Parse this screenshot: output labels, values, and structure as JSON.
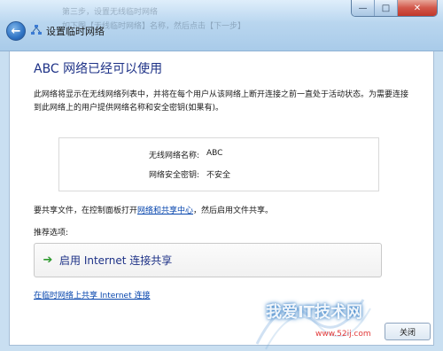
{
  "window": {
    "title": "设置临时网络",
    "background_ghost_line1": "第三步，设置无线临时网络",
    "background_ghost_line2": "如下图【无线临时网络】名称，然后点击【下一步】",
    "minimize_glyph": "—",
    "maximize_glyph": "□",
    "close_glyph": "✕",
    "back_glyph": "←",
    "back_icon": "back-arrow-icon",
    "network_icon": "ad-hoc-network-icon"
  },
  "content": {
    "heading": "ABC 网络已经可以使用",
    "description": "此网络将显示在无线网络列表中，并将在每个用户从该网络上断开连接之前一直处于活动状态。为需要连接到此网络上的用户提供网络名称和安全密钥(如果有)。",
    "network_info": {
      "name_label": "无线网络名称:",
      "name_value": "ABC",
      "security_label": "网络安全密钥:",
      "security_value": "不安全"
    },
    "share_prefix": "要共享文件，在控制面板打开",
    "share_link": "网络和共享中心",
    "share_suffix": "，然后启用文件共享。",
    "recommended_label": "推荐选项:",
    "command_button_label": "启用 Internet 连接共享",
    "command_button_icon": "green-arrow-icon",
    "bottom_link": "在临时网络上共享 Internet 连接",
    "close_button_label": "关闭"
  },
  "watermark": {
    "text": "我爱IT技术网",
    "url": "www.52ij.com"
  },
  "colors": {
    "heading": "#1e3287",
    "link": "#0645ad",
    "titlebar": "#b9d6ef",
    "arrow": "#2e9a2e"
  }
}
